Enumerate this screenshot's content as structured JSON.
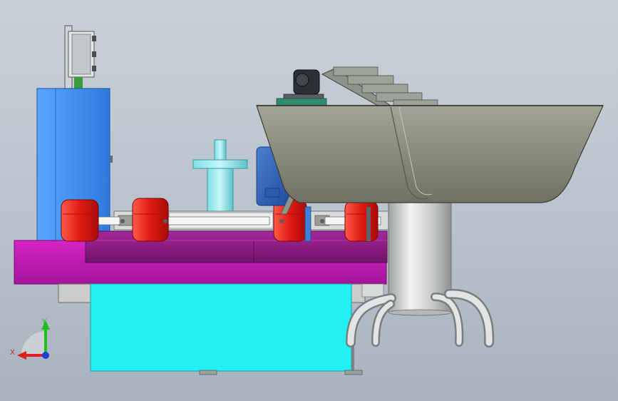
{
  "viewport": {
    "background_top": "#c9d0d9",
    "background_bottom": "#a9b3bf"
  },
  "triad": {
    "x_label": "X",
    "y_label": "Y",
    "x_color": "#e02020",
    "y_color": "#1fbf1f",
    "z_color": "#1d3fd8"
  },
  "colors": {
    "cabinet_blue": "#3f8df0",
    "table_magenta": "#c417b3",
    "turntable_purple": "#8a1a80",
    "base_cyan": "#22f0f2",
    "cup_red": "#e02020",
    "hopper_gray": "#8f9180",
    "steel": "#d6d8d8"
  }
}
